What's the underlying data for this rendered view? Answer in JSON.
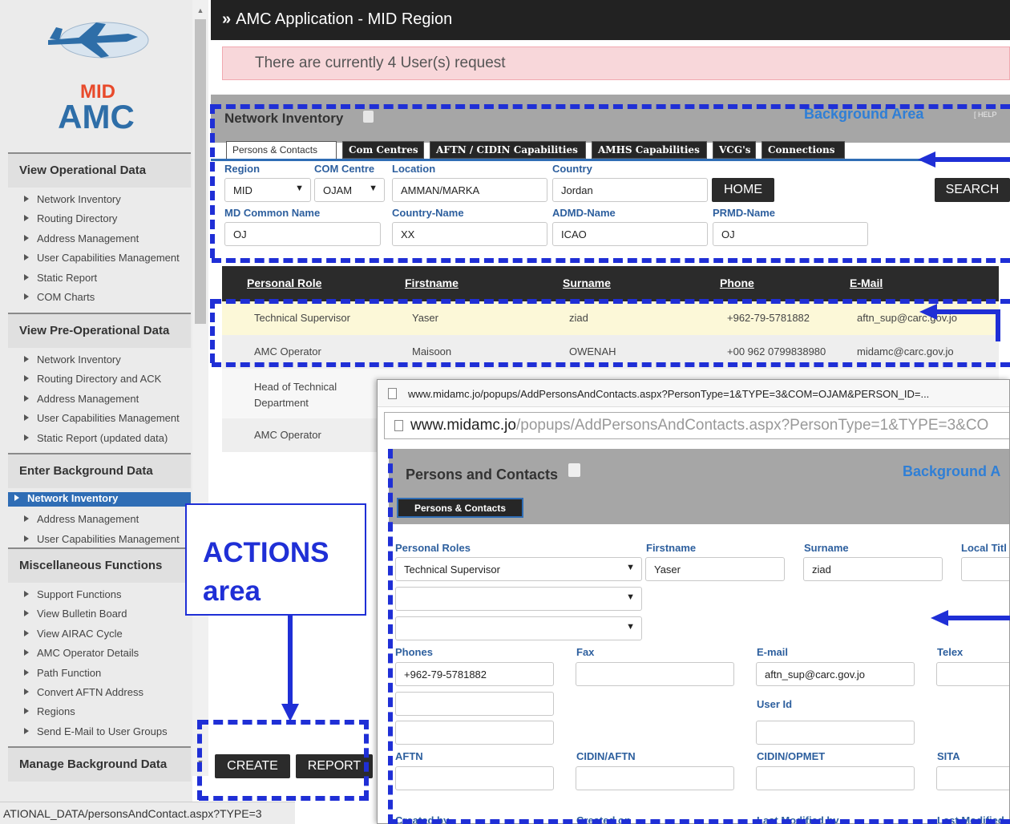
{
  "window": {
    "title": "AMC Application - MID Region",
    "title_icon": "double-chevron-right-icon"
  },
  "alert": {
    "text": "There are currently 4 User(s) request"
  },
  "logo": {
    "line1": "MID",
    "line2": "AMC",
    "colors": {
      "primary": "#2e6ea8",
      "accent": "#e84a2b"
    }
  },
  "sidebar": {
    "sections": [
      {
        "title": "View Operational Data",
        "items": [
          "Network Inventory",
          "Routing Directory",
          "Address Management",
          "User Capabilities Management",
          "Static Report",
          "COM Charts"
        ]
      },
      {
        "title": "View Pre-Operational Data",
        "items": [
          "Network Inventory",
          "Routing Directory and ACK",
          "Address Management",
          "User Capabilities Management",
          "Static Report (updated data)"
        ]
      },
      {
        "title": "Enter Background Data",
        "items": [
          "Network Inventory",
          "Address Management",
          "User Capabilities Management"
        ],
        "active": "Network Inventory"
      },
      {
        "title": "Miscellaneous Functions",
        "items": [
          "Support Functions",
          "View Bulletin Board",
          "View AIRAC Cycle",
          "AMC Operator Details",
          "Path Function",
          "Convert AFTN Address",
          "Regions",
          "Send E-Mail to User Groups"
        ]
      },
      {
        "title": "Manage Background Data",
        "items": []
      }
    ]
  },
  "status_bar": {
    "text": "ATIONAL_DATA/personsAndContact.aspx?TYPE=3"
  },
  "panel": {
    "title": "Network Inventory",
    "area_label": "Background Area",
    "help_label": "[ HELP",
    "tabs": [
      "Persons & Contacts",
      "Com Centres",
      "AFTN / CIDIN Capabilities",
      "AMHS Capabilities",
      "VCG's",
      "Connections"
    ],
    "selected_tab": "Persons & Contacts",
    "fields": {
      "region": {
        "label": "Region",
        "value": "MID"
      },
      "com_centre": {
        "label": "COM Centre",
        "value": "OJAM"
      },
      "location": {
        "label": "Location",
        "value": "AMMAN/MARKA"
      },
      "country": {
        "label": "Country",
        "value": "Jordan"
      },
      "md_common_name": {
        "label": "MD Common Name",
        "value": "OJ"
      },
      "country_name": {
        "label": "Country-Name",
        "value": "XX"
      },
      "admd_name": {
        "label": "ADMD-Name",
        "value": "ICAO"
      },
      "prmd_name": {
        "label": "PRMD-Name",
        "value": "OJ"
      }
    },
    "buttons": {
      "home": "HOME",
      "search": "SEARCH"
    }
  },
  "table": {
    "columns": [
      "Personal Role",
      "Firstname",
      "Surname",
      "Phone",
      "E-Mail"
    ],
    "rows": [
      [
        "Technical Supervisor",
        "Yaser",
        "ziad",
        "+962-79-5781882",
        "aftn_sup@carc.gov.jo"
      ],
      [
        "AMC Operator",
        "Maisoon",
        "OWENAH",
        "+00 962 0799838980",
        "midamc@carc.gov.jo"
      ],
      [
        "Head of Technical Department",
        "",
        "",
        "",
        ""
      ],
      [
        "AMC Operator",
        "",
        "",
        "",
        ""
      ]
    ],
    "row_colors": [
      "#fcf8d8",
      "#eeeeee",
      "#f7f7f7",
      "#eeeeee"
    ]
  },
  "actions": {
    "create": "CREATE",
    "report": "REPORT"
  },
  "annotation": {
    "actions_line1": "ACTIONS",
    "actions_line2": "area",
    "color": "#1f2fd6"
  },
  "popup": {
    "titlebar_url": "www.midamc.jo/popups/AddPersonsAndContacts.aspx?PersonType=1&TYPE=3&COM=OJAM&PERSON_ID=...",
    "url_domain": "www.midamc.jo",
    "url_path": "/popups/AddPersonsAndContacts.aspx?PersonType=1&TYPE=3&CO",
    "title": "Persons and Contacts",
    "area_label": "Background A",
    "tab": "Persons & Contacts",
    "labels": {
      "personal_roles": "Personal Roles",
      "firstname": "Firstname",
      "surname": "Surname",
      "local_title": "Local Titl",
      "phones": "Phones",
      "fax": "Fax",
      "email": "E-mail",
      "telex": "Telex",
      "user_id": "User Id",
      "aftn": "AFTN",
      "cidin_aftn": "CIDIN/AFTN",
      "cidin_opmet": "CIDIN/OPMET",
      "sita": "SITA",
      "created_by": "Created by",
      "created_on": "Created on",
      "last_modified_by": "Last Modified by",
      "last_modified": "Last Modified"
    },
    "values": {
      "personal_role": "Technical Supervisor",
      "firstname": "Yaser",
      "surname": "ziad",
      "phone": "+962-79-5781882",
      "email": "aftn_sup@carc.gov.jo"
    }
  }
}
